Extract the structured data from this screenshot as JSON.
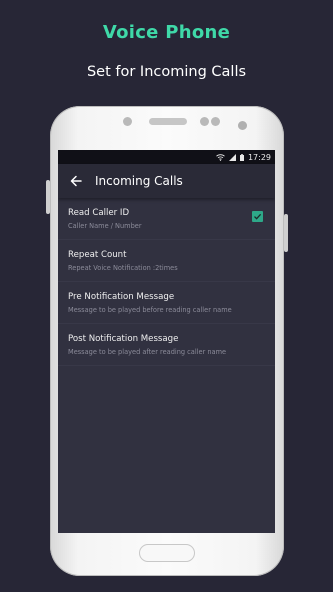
{
  "promo": {
    "title": "Voice Phone",
    "subtitle": "Set for Incoming Calls"
  },
  "status_bar": {
    "time": "17:29",
    "icons": [
      "wifi-icon",
      "signal-icon",
      "battery-icon"
    ]
  },
  "toolbar": {
    "back_icon": "arrow-back-icon",
    "title": "Incoming Calls"
  },
  "settings": [
    {
      "title": "Read Caller ID",
      "subtitle": "Caller Name / Number",
      "checkbox": true,
      "checked": true
    },
    {
      "title": "Repeat Count",
      "subtitle": "Repeat Voice Notification :2times",
      "checkbox": false
    },
    {
      "title": "Pre Notification Message",
      "subtitle": "Message to be played before reading caller name",
      "checkbox": false
    },
    {
      "title": "Post Notification Message",
      "subtitle": "Message to be played after reading caller name",
      "checkbox": false
    }
  ],
  "colors": {
    "background": "#272636",
    "accent": "#3fd9a8",
    "checkbox": "#2ea889",
    "screen": "#313140"
  }
}
